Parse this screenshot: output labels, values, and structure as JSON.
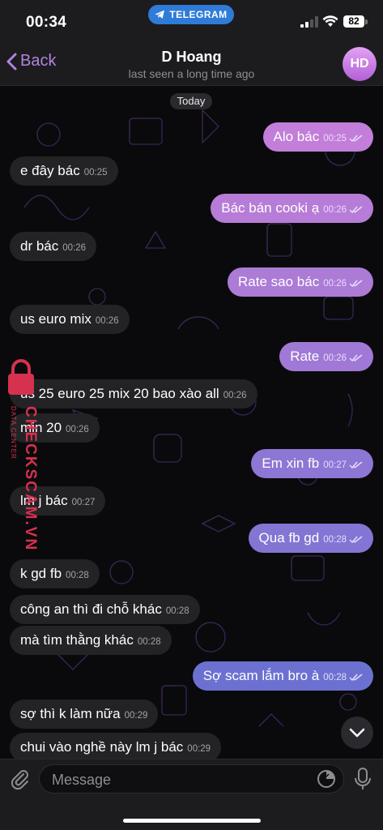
{
  "status_bar": {
    "time": "00:34",
    "app_pill": "TELEGRAM",
    "battery": "82"
  },
  "header": {
    "back_label": "Back",
    "contact_name": "D Hoang",
    "last_seen": "last seen a long time ago",
    "avatar_initials": "HD"
  },
  "chat": {
    "date_label": "Today",
    "messages": [
      {
        "dir": "out",
        "text": "Alo bác",
        "time": "00:25",
        "read": true
      },
      {
        "dir": "in",
        "text": "e đây bác",
        "time": "00:25"
      },
      {
        "dir": "out",
        "text": "Bác bán cooki ạ",
        "time": "00:26",
        "read": true
      },
      {
        "dir": "in",
        "text": "dr bác",
        "time": "00:26"
      },
      {
        "dir": "out",
        "text": "Rate sao bác",
        "time": "00:26",
        "read": true
      },
      {
        "dir": "in",
        "text": "us euro mix",
        "time": "00:26"
      },
      {
        "dir": "out",
        "text": "Rate",
        "time": "00:26",
        "read": true
      },
      {
        "dir": "in",
        "text": "us 25 euro 25 mix 20 bao xào all",
        "time": "00:26"
      },
      {
        "dir": "in",
        "text": "min 20",
        "time": "00:26"
      },
      {
        "dir": "out",
        "text": "Em xin fb",
        "time": "00:27",
        "read": true
      },
      {
        "dir": "in",
        "text": "lm j bác",
        "time": "00:27"
      },
      {
        "dir": "out",
        "text": "Qua fb gd",
        "time": "00:28",
        "read": true
      },
      {
        "dir": "in",
        "text": "k gd fb",
        "time": "00:28"
      },
      {
        "dir": "in",
        "text": "công an thì đi chỗ khác",
        "time": "00:28"
      },
      {
        "dir": "in",
        "text": "mà tìm thằng khác",
        "time": "00:28"
      },
      {
        "dir": "out",
        "text": "Sợ scam lắm bro à",
        "time": "00:28",
        "read": true
      },
      {
        "dir": "in",
        "text": "sợ thì k làm nữa",
        "time": "00:29"
      },
      {
        "dir": "in",
        "text": "chui vào nghề này lm j bác",
        "time": "00:29"
      }
    ]
  },
  "watermark": {
    "brand": "CHECKSCAM.VN",
    "sub": "DATA CENTER"
  },
  "input": {
    "placeholder": "Message"
  },
  "colors": {
    "outgoing_top": "#c87fd8",
    "outgoing_bottom": "#5c6fd0",
    "incoming": "#232326",
    "accent": "#b283e0"
  }
}
